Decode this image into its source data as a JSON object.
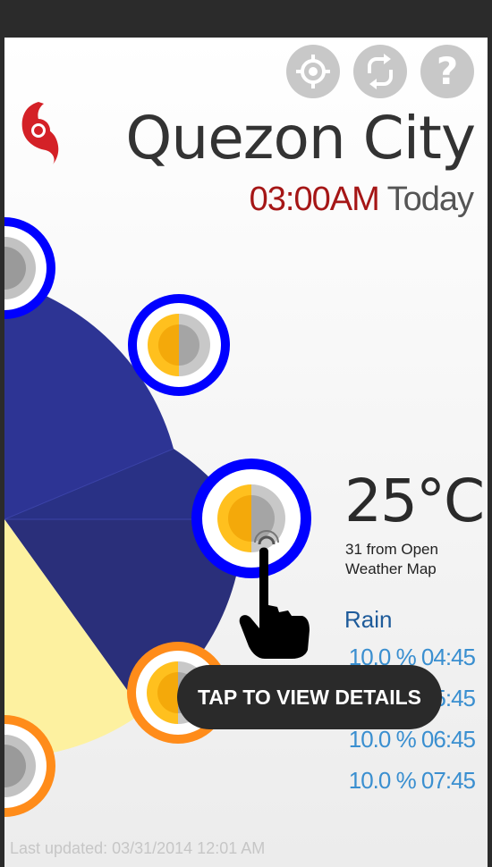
{
  "header": {
    "city": "Quezon City",
    "time": "03:00AM",
    "day": "Today"
  },
  "buttons": [
    {
      "icon": "crosshair-icon"
    },
    {
      "icon": "refresh-icon"
    },
    {
      "icon": "help-icon",
      "glyph": "?"
    }
  ],
  "weather": {
    "temperature": "25°C",
    "source": "31 from Open Weather Map"
  },
  "rain": {
    "title": "Rain",
    "rows": [
      {
        "text": "10.0 % 04:45"
      },
      {
        "text": "10.0 % 05:45"
      },
      {
        "text": "10.0 % 06:45"
      },
      {
        "text": "10.0 % 07:45"
      }
    ]
  },
  "toast": "TAP TO VIEW DETAILS",
  "footer": {
    "updated": "Last updated: 03/31/2014 12:01 AM"
  },
  "colors": {
    "night_sector": "#2d3494",
    "day_sector": "#fdf1a0",
    "ring_night": "#0000ff",
    "ring_day": "#ff8c1a",
    "time_red": "#a51616",
    "rain_blue": "#3a8fd0"
  }
}
